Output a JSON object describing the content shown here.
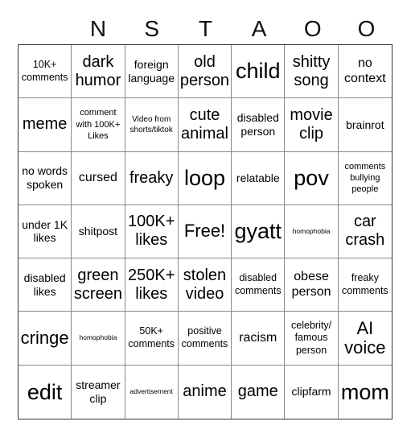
{
  "header": {
    "letters": [
      "",
      "N",
      "S",
      "T",
      "A",
      "O",
      "O"
    ]
  },
  "cells": [
    [
      "10K+ comments",
      "dark humor",
      "foreign language",
      "old person",
      "child",
      "shitty song",
      "no context"
    ],
    [
      "meme",
      "comment with 100K+ Likes",
      "Video from shorts/tiktok",
      "cute animal",
      "disabled person",
      "movie clip",
      "brainrot"
    ],
    [
      "no words spoken",
      "cursed",
      "freaky",
      "loop",
      "relatable",
      "pov",
      "comments bullying people"
    ],
    [
      "under 1K likes",
      "shitpost",
      "100K+ likes",
      "Free!",
      "gyatt",
      "homophobia",
      "car crash"
    ],
    [
      "disabled likes",
      "green screen",
      "250K+ likes",
      "stolen video",
      "disabled comments",
      "obese person",
      "freaky comments"
    ],
    [
      "cringe",
      "homophobia",
      "50K+ comments",
      "positive comments",
      "racism",
      "celebrity/ famous person",
      "AI voice"
    ],
    [
      "edit",
      "streamer clip",
      "advertisement",
      "anime",
      "game",
      "clipfarm",
      "mom"
    ]
  ]
}
